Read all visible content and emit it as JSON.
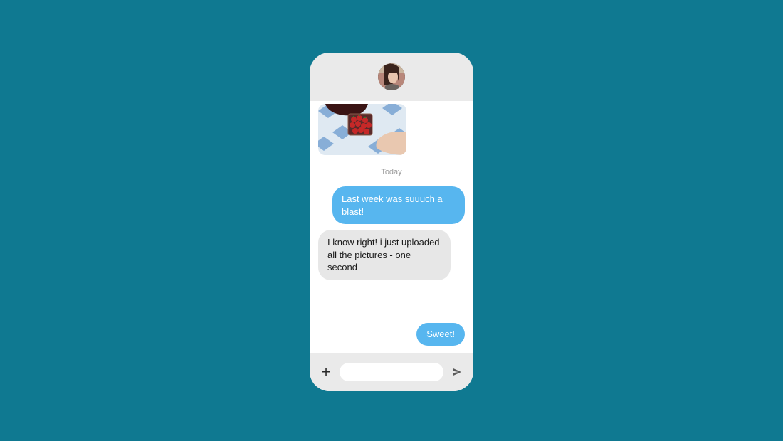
{
  "header": {
    "avatar_name": "contact-avatar"
  },
  "chat": {
    "image_message_alt": "photo attachment",
    "date_separator": "Today",
    "messages": [
      {
        "side": "sent",
        "text": "Last week was suuuch a blast!"
      },
      {
        "side": "received",
        "text": "I know right! i just uploaded all the pictures - one second"
      },
      {
        "side": "sent",
        "text": "Sweet!"
      }
    ]
  },
  "composer": {
    "plus_label": "+",
    "input_placeholder": "",
    "send_label": "Send"
  },
  "colors": {
    "page_bg": "#0f7991",
    "phone_bg": "#ffffff",
    "bar_bg": "#eaeaea",
    "sent_bubble": "#57b6ef",
    "received_bubble": "#e7e7e7"
  }
}
